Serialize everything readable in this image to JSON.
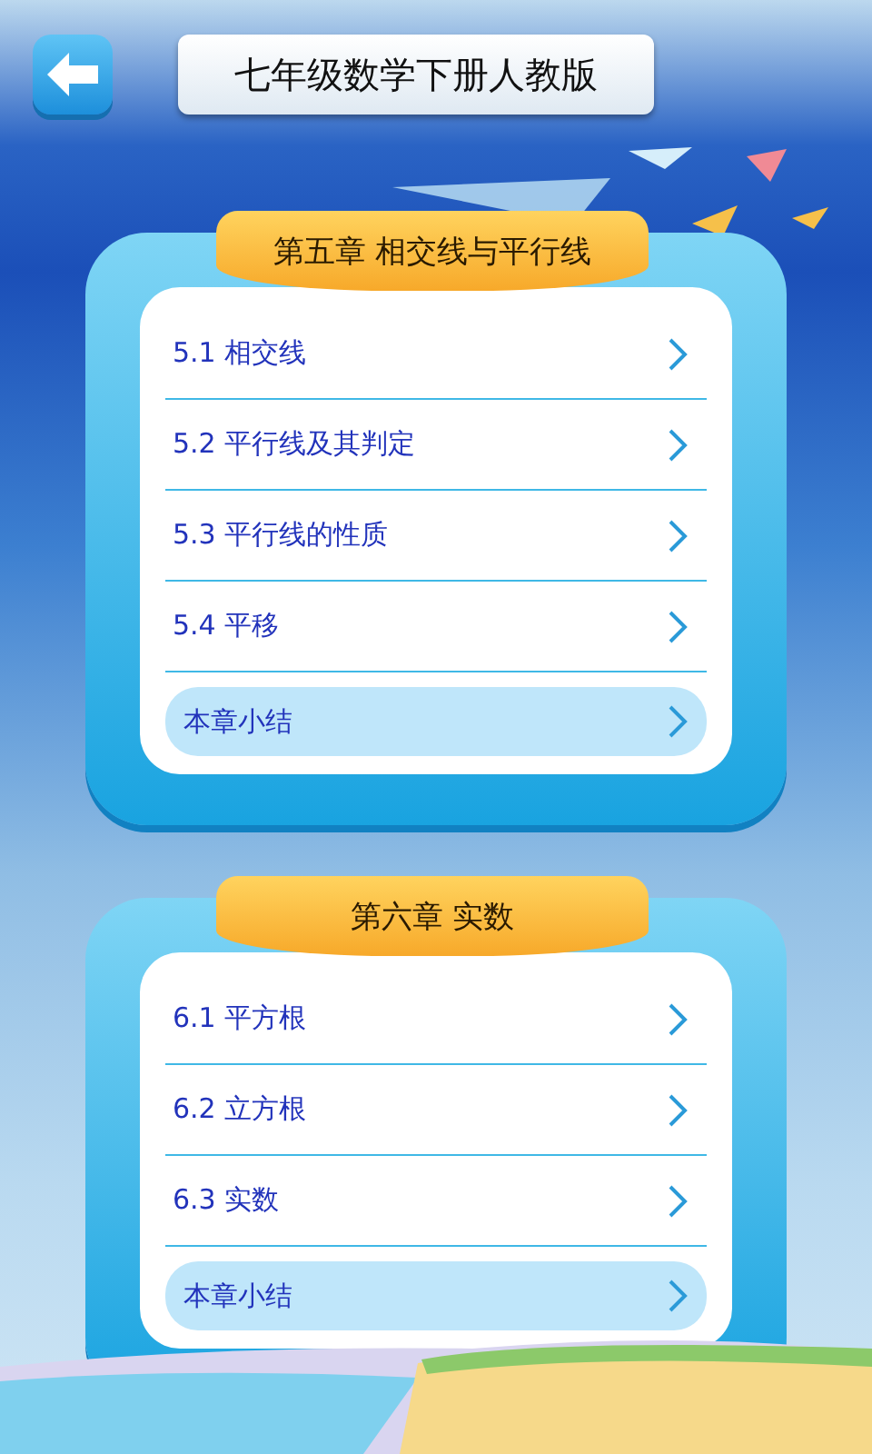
{
  "header": {
    "title": "七年级数学下册人教版"
  },
  "chapters": [
    {
      "title": "第五章  相交线与平行线",
      "items": [
        {
          "label": "5.1 相交线",
          "kind": "section"
        },
        {
          "label": "5.2 平行线及其判定",
          "kind": "section"
        },
        {
          "label": "5.3 平行线的性质",
          "kind": "section"
        },
        {
          "label": "5.4 平移",
          "kind": "section"
        },
        {
          "label": "本章小结",
          "kind": "summary"
        }
      ]
    },
    {
      "title": "第六章  实数",
      "items": [
        {
          "label": "6.1 平方根",
          "kind": "section"
        },
        {
          "label": "6.2 立方根",
          "kind": "section"
        },
        {
          "label": "6.3 实数",
          "kind": "section"
        },
        {
          "label": "本章小结",
          "kind": "summary"
        }
      ]
    }
  ]
}
